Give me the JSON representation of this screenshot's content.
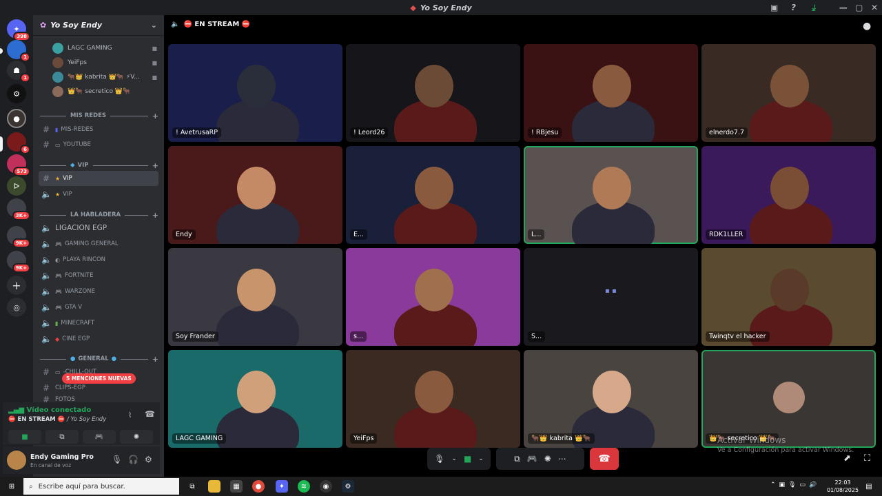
{
  "window": {
    "title": "Yo Soy Endy"
  },
  "servers": [
    {
      "name": "discord-home",
      "badge": "398"
    },
    {
      "name": "server-2",
      "badge": "1"
    },
    {
      "name": "server-3",
      "badge": "1"
    },
    {
      "name": "server-4",
      "badge": ""
    },
    {
      "name": "server-5",
      "badge": ""
    },
    {
      "name": "server-6",
      "badge": "6"
    },
    {
      "name": "server-7",
      "badge": "573"
    },
    {
      "name": "server-8",
      "badge": ""
    },
    {
      "name": "server-9",
      "badge": "3K+"
    },
    {
      "name": "server-10",
      "badge": "9K+"
    },
    {
      "name": "server-11",
      "badge": "9K+"
    }
  ],
  "server_header": {
    "name": "Yo Soy Endy"
  },
  "voice_members": [
    {
      "name": "LAGC GAMING"
    },
    {
      "name": "YeiFps"
    },
    {
      "name": "🐂👑 kabrita 👑🐂 ⚡V..."
    },
    {
      "name": "👑🐂 secretico 👑🐂"
    }
  ],
  "categories": {
    "mis_redes": "MIS REDES",
    "vip": "VIP",
    "la_habladera": "LA HABLADERA",
    "general": "GENERAL"
  },
  "channels": {
    "mis_redes": "MIS-REDES",
    "youtube": "YOUTUBE",
    "vip_text": "VIP",
    "vip_voice": "VIP",
    "ligacion": "LIGACION EGP",
    "gaming_general": "GAMING GENERAL",
    "playa_rincon": "PLAYA RINCON",
    "fortnite": "FORTNITE",
    "warzone": "WARZONE",
    "gta": "GTA V",
    "minecraft": "MINECRAFT",
    "cine": "CINE EGP",
    "chill": "-CHILL-OUT",
    "clips": "CLIPS-EGP",
    "fotos": "FOTOS"
  },
  "new_mentions": "5 MENCIONES NUEVAS",
  "voice_panel": {
    "status": "Vídeo conectado",
    "channel": "⛔ EN STREAM ⛔",
    "server": "/ Yo Soy Endy"
  },
  "user_panel": {
    "name": "Endy Gaming Pro",
    "status": "En canal de voz"
  },
  "stage": {
    "channel_title": "⛔ EN STREAM ⛔"
  },
  "tiles": [
    {
      "name": "! AvetrusaRP",
      "bg": "#1a1e4a",
      "skin": "#2a2e3a"
    },
    {
      "name": "! Leord26",
      "bg": "#15151a",
      "skin": "#6b4a36"
    },
    {
      "name": "! RBjesu",
      "bg": "#3a1214",
      "skin": "#8a5a3e"
    },
    {
      "name": "elnerdo7.7",
      "bg": "#3a2a24",
      "skin": "#7a5238"
    },
    {
      "name": "Endy",
      "bg": "#4a1a1a",
      "skin": "#c48a66"
    },
    {
      "name": "E...",
      "bg": "#1a1f3a",
      "skin": "#8a5a3e"
    },
    {
      "name": "L...",
      "bg": "#5a5250",
      "skin": "#b07a56"
    },
    {
      "name": "RDK1LLER",
      "bg": "#3a1a5a",
      "skin": "#7a4e34"
    },
    {
      "name": "Soy Frander",
      "bg": "#3a3840",
      "skin": "#c8946c"
    },
    {
      "name": "s...",
      "bg": "#8a3a9a",
      "skin": "#a0704e"
    },
    {
      "name": "S...",
      "bg": "#1a1a1e",
      "skin": ""
    },
    {
      "name": "Twinqtv el hacker",
      "bg": "#5a4a30",
      "skin": "#5a3a28"
    },
    {
      "name": "LAGC GAMING",
      "bg": "#1a6a6a",
      "skin": "#d0a07a"
    },
    {
      "name": "YeiFps",
      "bg": "#3a2a22",
      "skin": "#8a5a3e"
    },
    {
      "name": "🐂👑 kabrita 👑🐂",
      "bg": "#4a4440",
      "skin": "#d8a88a"
    },
    {
      "name": "👑🐂 secretico 👑🐂",
      "bg": "#3a3634",
      "skin": ""
    }
  ],
  "watermark": {
    "title": "Activar Windows",
    "subtitle": "Ve a Configuración para activar Windows."
  },
  "taskbar": {
    "search_placeholder": "Escribe aquí para buscar.",
    "time": "22:03",
    "date": "01/08/2025"
  }
}
